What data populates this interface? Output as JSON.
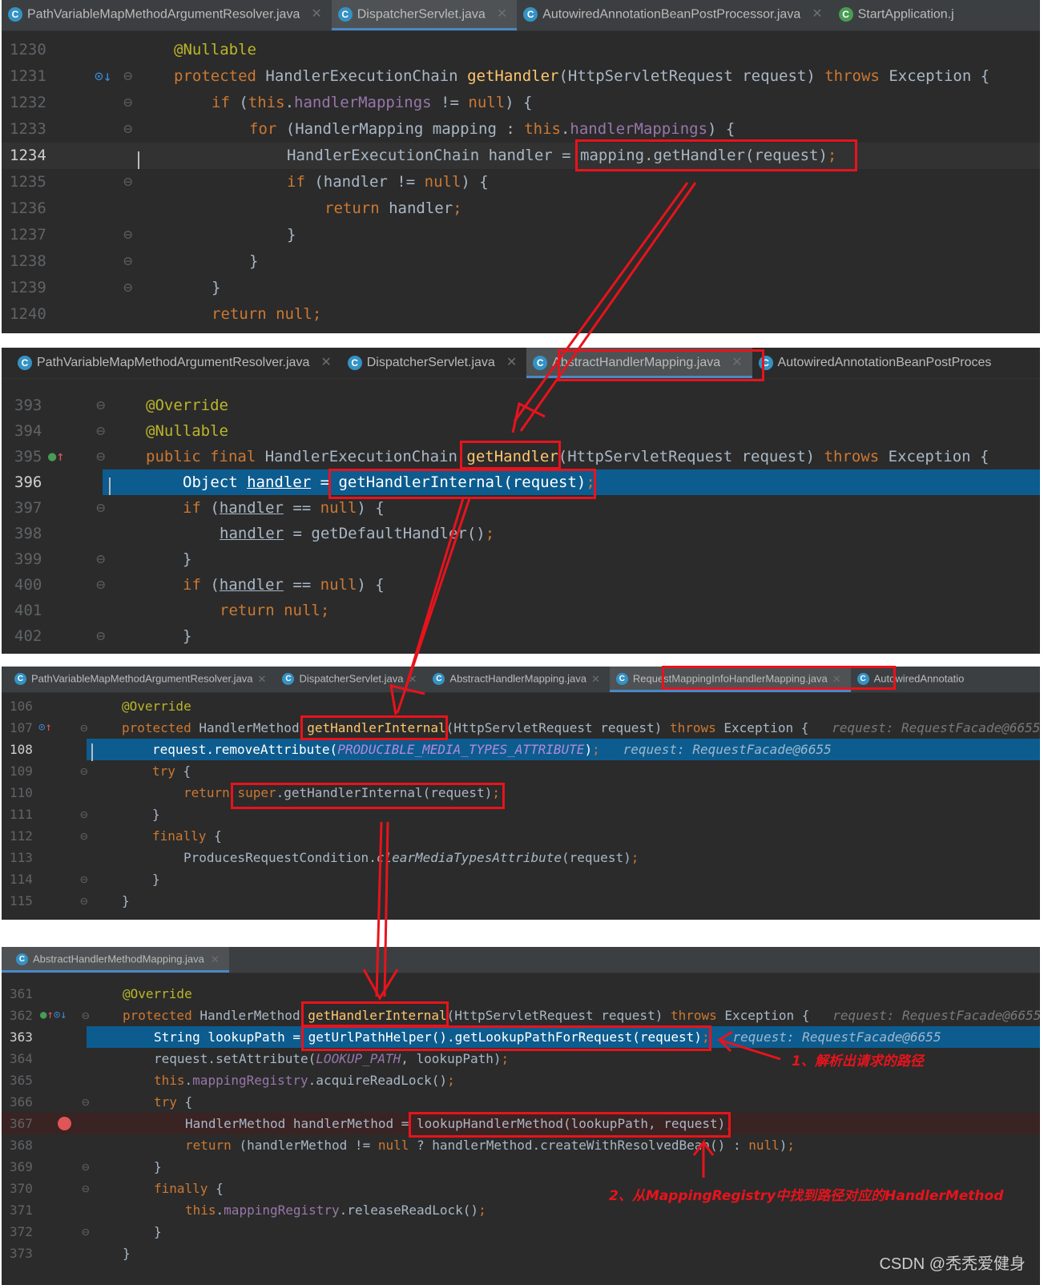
{
  "panel1": {
    "tabs": [
      {
        "label": "PathVariableMapMethodArgumentResolver.java",
        "active": false
      },
      {
        "label": "DispatcherServlet.java",
        "active": true
      },
      {
        "label": "AutowiredAnnotationBeanPostProcessor.java",
        "active": false
      },
      {
        "label": "StartApplication.j",
        "active": false
      }
    ],
    "line_numbers": [
      "1230",
      "1231",
      "1232",
      "1233",
      "1234",
      "1235",
      "1236",
      "1237",
      "1238",
      "1239",
      "1240"
    ],
    "code": {
      "l1230_ann": "@Nullable",
      "l1231_kw1": "protected",
      "l1231_t1": "HandlerExecutionChain",
      "l1231_fn": "getHandler",
      "l1231_t2": "(HttpServletRequest request)",
      "l1231_kw2": "throws",
      "l1231_t3": "Exception {",
      "l1232_kw": "if",
      "l1232_t1": "(",
      "l1232_this": "this",
      "l1232_dot": ".",
      "l1232_fld": "handlerMappings",
      "l1232_t2": " != ",
      "l1232_null": "null",
      "l1232_t3": ") {",
      "l1233_kw": "for",
      "l1233_t1": "(HandlerMapping mapping : ",
      "l1233_this": "this",
      "l1233_dot": ".",
      "l1233_fld": "handlerMappings",
      "l1233_t2": ") {",
      "l1234_t1": "HandlerExecutionChain handler = ",
      "l1234_t2": "mapping.getHandler(request)",
      "l1234_semi": ";",
      "l1235_kw": "if",
      "l1235_t1": "(handler != ",
      "l1235_null": "null",
      "l1235_t2": ") {",
      "l1236_kw": "return",
      "l1236_t1": "handler",
      "l1236_semi": ";",
      "l1237": "}",
      "l1238": "}",
      "l1239": "}",
      "l1240_kw": "return",
      "l1240_null": "null",
      "l1240_semi": ";"
    }
  },
  "panel2": {
    "tabs": [
      {
        "label": "PathVariableMapMethodArgumentResolver.java",
        "active": false
      },
      {
        "label": "DispatcherServlet.java",
        "active": false
      },
      {
        "label": "AbstractHandlerMapping.java",
        "active": true
      },
      {
        "label": "AutowiredAnnotationBeanPostProces",
        "active": false
      }
    ],
    "line_numbers": [
      "393",
      "394",
      "395",
      "396",
      "397",
      "398",
      "399",
      "400",
      "401",
      "402"
    ],
    "code": {
      "l393_ann": "@Override",
      "l394_ann": "@Nullable",
      "l395_kw1": "public final",
      "l395_t1": "HandlerExecutionChain",
      "l395_fn": "getHandler",
      "l395_t2": "(HttpServletRequest request)",
      "l395_kw2": "throws",
      "l395_t3": "Exception {",
      "l396_t1": "Object ",
      "l396_var": "handler",
      "l396_t2": " = ",
      "l396_t3": "getHandlerInternal(request)",
      "l396_semi": ";",
      "l397_kw": "if",
      "l397_t1": "(",
      "l397_var": "handler",
      "l397_t2": " == ",
      "l397_null": "null",
      "l397_t3": ") {",
      "l398_var": "handler",
      "l398_t1": " = getDefaultHandler()",
      "l398_semi": ";",
      "l399": "}",
      "l400_kw": "if",
      "l400_t1": "(",
      "l400_var": "handler",
      "l400_t2": " == ",
      "l400_null": "null",
      "l400_t3": ") {",
      "l401_kw": "return",
      "l401_null": "null",
      "l401_semi": ";",
      "l402": "}"
    }
  },
  "panel3": {
    "tabs": [
      {
        "label": "PathVariableMapMethodArgumentResolver.java",
        "active": false
      },
      {
        "label": "DispatcherServlet.java",
        "active": false
      },
      {
        "label": "AbstractHandlerMapping.java",
        "active": false
      },
      {
        "label": "RequestMappingInfoHandlerMapping.java",
        "active": true
      },
      {
        "label": "AutowiredAnnotatio",
        "active": false
      }
    ],
    "line_numbers": [
      "106",
      "107",
      "108",
      "109",
      "110",
      "111",
      "112",
      "113",
      "114",
      "115"
    ],
    "code": {
      "l106_ann": "@Override",
      "l107_kw1": "protected",
      "l107_t1": "HandlerMethod",
      "l107_fn": "getHandlerInternal",
      "l107_t2": "(HttpServletRequest request)",
      "l107_kw2": "throws",
      "l107_t3": "Exception {",
      "l107_hint": "request: RequestFacade@6655",
      "l108_t1": "request.removeAttribute(",
      "l108_cst": "PRODUCIBLE_MEDIA_TYPES_ATTRIBUTE",
      "l108_t2": ")",
      "l108_semi": ";",
      "l108_hint": "request: RequestFacade@6655",
      "l109_kw": "try",
      "l109_t1": "{",
      "l110_kw": "return",
      "l110_super": "super",
      "l110_t1": ".getHandlerInternal(request)",
      "l110_semi": ";",
      "l111": "}",
      "l112_kw": "finally",
      "l112_t1": "{",
      "l113_t1": "ProducesRequestCondition.",
      "l113_it": "clearMediaTypesAttribute",
      "l113_t2": "(request)",
      "l113_semi": ";",
      "l114": "}",
      "l115": "}"
    }
  },
  "panel4": {
    "tabs": [
      {
        "label": "AbstractHandlerMethodMapping.java",
        "active": true
      }
    ],
    "line_numbers": [
      "361",
      "362",
      "363",
      "364",
      "365",
      "366",
      "367",
      "368",
      "369",
      "370",
      "371",
      "372",
      "373"
    ],
    "code": {
      "l361_ann": "@Override",
      "l362_kw1": "protected",
      "l362_t1": "HandlerMethod",
      "l362_fn": "getHandlerInternal",
      "l362_t2": "(HttpServletRequest request)",
      "l362_kw2": "throws",
      "l362_t3": "Exception {",
      "l362_hint": "request: RequestFacade@6655",
      "l363_t1": "String lookupPath = ",
      "l363_t2": "getUrlPathHelper().getLookupPathForRequest(request)",
      "l363_semi": ";",
      "l363_hint": "request: RequestFacade@6655",
      "l364_t1": "request.setAttribute(",
      "l364_cst": "LOOKUP_PATH",
      "l364_t2": ", lookupPath)",
      "l364_semi": ";",
      "l365_this": "this",
      "l365_dot": ".",
      "l365_fld": "mappingRegistry",
      "l365_t1": ".acquireReadLock()",
      "l365_semi": ";",
      "l366_kw": "try",
      "l366_t1": "{",
      "l367_t1": "HandlerMethod handlerMethod = ",
      "l367_t2": "lookupHandlerMethod(lookupPath, request)",
      "l367_semi": ";",
      "l368_kw": "return",
      "l368_t1": "(handlerMethod != ",
      "l368_null": "null",
      "l368_t2": " ? handlerMethod.createWithResolvedBean() : ",
      "l368_null2": "null",
      "l368_t3": ")",
      "l368_semi": ";",
      "l369": "}",
      "l370_kw": "finally",
      "l370_t1": "{",
      "l371_this": "this",
      "l371_dot": ".",
      "l371_fld": "mappingRegistry",
      "l371_t1": ".releaseReadLock()",
      "l371_semi": ";",
      "l372": "}",
      "l373": "}"
    }
  },
  "annotations": {
    "note1": "1、解析出请求的路径",
    "note2": "2、从MappingRegistry中找到路径对应的HandlerMethod"
  },
  "watermark": "CSDN @秃秃爱健身",
  "colors": {
    "editor_bg": "#2b2b2b",
    "tabbar_bg": "#3c3f41",
    "keyword": "#cc7832",
    "annotation": "#bbb529",
    "method_decl": "#ffc66d",
    "field": "#9876aa",
    "text": "#a9b7c6",
    "highlight_line": "#0d5c8f",
    "callout_red": "#e8131c"
  }
}
